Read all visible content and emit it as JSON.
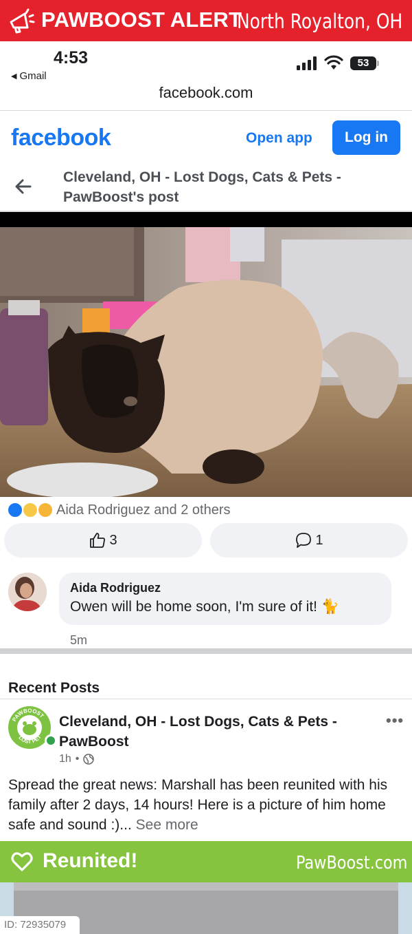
{
  "alert": {
    "title": "PAWBOOST ALERT",
    "location": "North Royalton, OH",
    "icon": "megaphone-icon"
  },
  "status_bar": {
    "time": "4:53",
    "back_app": "Gmail",
    "battery": "53",
    "url": "facebook.com"
  },
  "header": {
    "logo": "facebook",
    "open_app": "Open app",
    "login": "Log in"
  },
  "post": {
    "title": "Cleveland, OH - Lost Dogs, Cats & Pets - PawBoost's post",
    "reactions_text": "Aida Rodriguez and 2 others",
    "like_count": "3",
    "comment_count": "1"
  },
  "comment": {
    "author": "Aida Rodriguez",
    "text": "Owen will be home soon, I'm sure of it! 🐈",
    "time": "5m"
  },
  "recent": {
    "section_title": "Recent Posts",
    "page_name": "Cleveland, OH - Lost Dogs, Cats & Pets - PawBoost",
    "meta_time": "1h",
    "body": "Spread the great news: Marshall  has been reunited with his family after 2 days, 14 hours! Here is a picture of him home safe and sound :)...",
    "see_more": "See more",
    "avatar_text_top": "PAWBOOST",
    "avatar_text_bottom": "LOST PET"
  },
  "reunited": {
    "label": "Reunited!",
    "site": "PawBoost.com"
  },
  "footer": {
    "id": "ID: 72935079"
  },
  "colors": {
    "alert_red": "#e5222c",
    "facebook_blue": "#1877f2",
    "reunited_green": "#86c43f"
  }
}
